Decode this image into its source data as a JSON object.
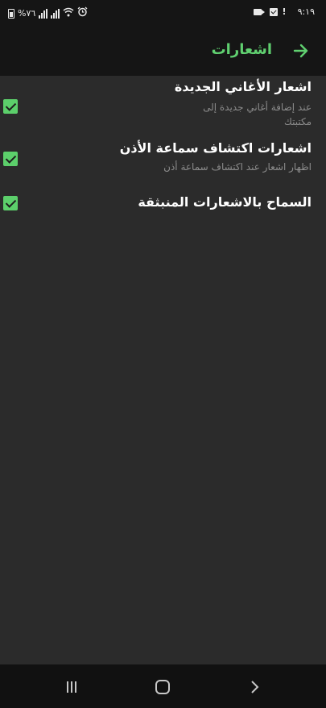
{
  "status_bar": {
    "battery_text": "%٧٦",
    "time": "٩:١٩"
  },
  "app_bar": {
    "title": "اشعارات",
    "back_icon": "arrow-right-icon"
  },
  "settings": [
    {
      "title": "اشعار الأغاني الجديدة",
      "subtitle": "عند إضافة أغاني جديدة إلى مكتبتك",
      "checked": true
    },
    {
      "title": "اشعارات اكتشاف سماعة الأذن",
      "subtitle": "اظهار اشعار عند اكتشاف سماعة أذن",
      "checked": true
    },
    {
      "title": "السماح بالاشعارات المنبثقة",
      "subtitle": "",
      "checked": true
    }
  ],
  "colors": {
    "accent": "#5ccf6b",
    "background": "#2b2b2b",
    "bar": "#151515",
    "subtitle": "#8c8c8c"
  }
}
